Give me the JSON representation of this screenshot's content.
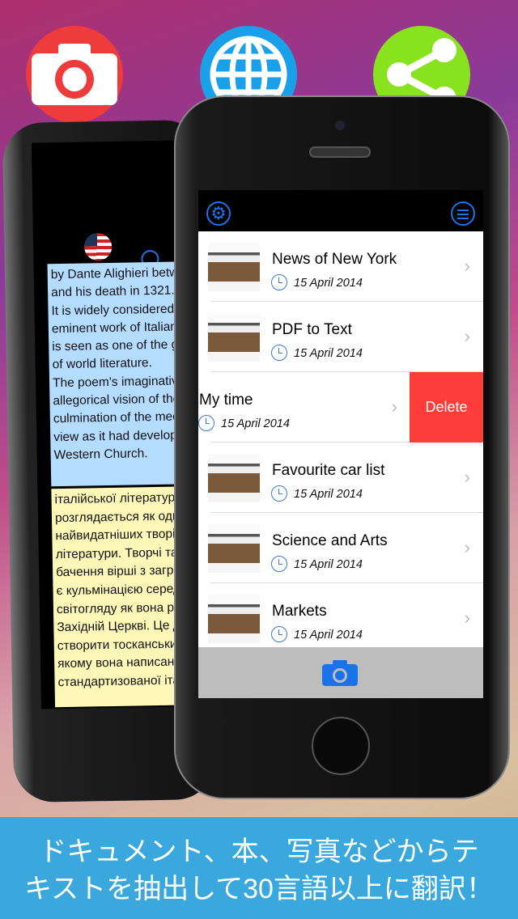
{
  "promo": {
    "icons": [
      {
        "name": "camera-icon",
        "color": "#ee3c3c"
      },
      {
        "name": "globe-icon",
        "color": "#19a0e8"
      },
      {
        "name": "share-icon",
        "color": "#88e21e"
      }
    ],
    "caption_line1": "ドキュメント、本、写真などからテ",
    "caption_line2": "キストを抽出して30言語以上に翻訳！"
  },
  "left_phone": {
    "source_lines": [
      "by Dante Alighieri betw",
      "and his death in 1321.",
      "It is widely considered",
      "eminent work of Italian",
      "is seen as one of the g",
      "of world literature.",
      "The poem's imaginativ",
      "allegorical vision of the",
      "culmination of the mec",
      "view as it had develop",
      "Western Church."
    ],
    "translated_lines": [
      "італійської літератури",
      "розглядається як оди",
      "найвидатніших творів",
      "літератури. Творчі та",
      "бачення вірші з загро",
      "є кульмінацією серед",
      "світогляду як вона ро",
      "Західній Церкві. Це д",
      "створити тосканськи",
      "якому вона написана",
      "стандартизованої іта"
    ]
  },
  "app": {
    "items": [
      {
        "title": "News of New York",
        "date": "15 April 2014"
      },
      {
        "title": "PDF to Text",
        "date": "15 April 2014"
      },
      {
        "title": "My time",
        "date": "15 April 2014"
      },
      {
        "title": "Favourite car list",
        "date": "15 April 2014"
      },
      {
        "title": "Science and Arts",
        "date": "15 April 2014"
      },
      {
        "title": "Markets",
        "date": "15 April 2014"
      }
    ],
    "delete_label": "Delete",
    "accent": "#1a73e8",
    "delete_color": "#fc3d39"
  }
}
